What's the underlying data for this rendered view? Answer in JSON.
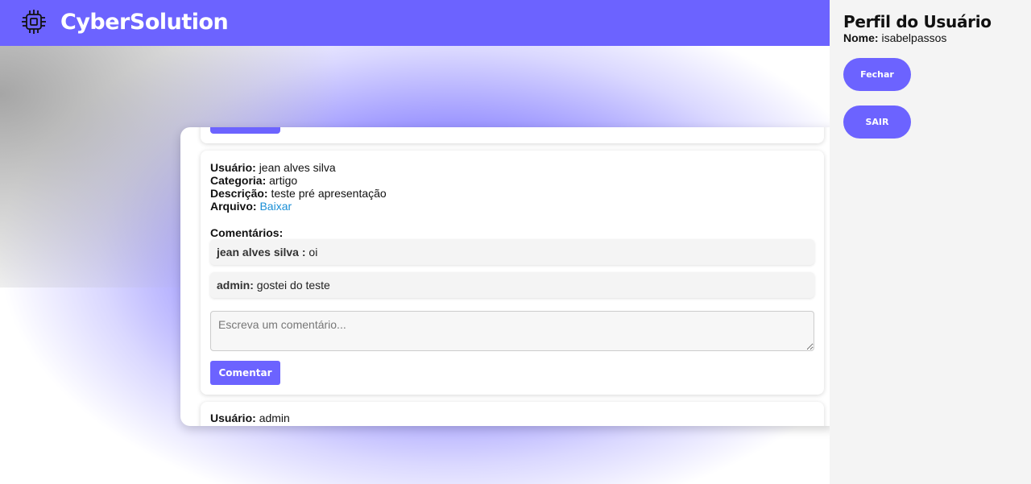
{
  "header": {
    "brand": "CyberSolution",
    "logo_icon": "chip-icon",
    "color": "#6c63ff"
  },
  "posts": [
    {
      "user_label": "Usuário:",
      "user": "jean alves silva",
      "category_label": "Categoria:",
      "category": "artigo",
      "description_label": "Descrição:",
      "description": "teste pré apresentação",
      "file_label": "Arquivo:",
      "file_link": "Baixar",
      "comments_title": "Comentários:",
      "comments": [
        {
          "author": "jean alves silva :",
          "text": "oi"
        },
        {
          "author": "admin:",
          "text": "gostei do teste"
        }
      ],
      "comment_placeholder": "Escreva um comentário...",
      "comment_button": "Comentar"
    },
    {
      "user_label": "Usuário:",
      "user": "admin"
    }
  ],
  "sidebar": {
    "title": "Perfil do Usuário",
    "name_label": "Nome:",
    "name": "isabelpassos",
    "close_button": "Fechar",
    "exit_button": "SAIR"
  }
}
